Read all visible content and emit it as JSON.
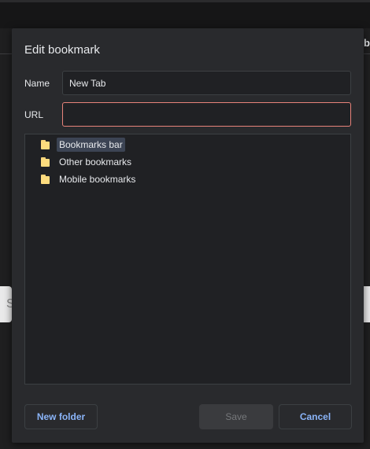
{
  "background": {
    "right_edge_text": "b",
    "left_edge_text": "S"
  },
  "dialog": {
    "title": "Edit bookmark",
    "name_label": "Name",
    "name_value": "New Tab",
    "url_label": "URL",
    "url_value": "",
    "folders": [
      {
        "label": "Bookmarks bar",
        "selected": true
      },
      {
        "label": "Other bookmarks",
        "selected": false
      },
      {
        "label": "Mobile bookmarks",
        "selected": false
      }
    ],
    "buttons": {
      "new_folder": "New folder",
      "save": "Save",
      "cancel": "Cancel"
    }
  },
  "colors": {
    "dialog_bg": "#292a2d",
    "input_bg": "#202124",
    "accent": "#8ab4f8",
    "error_border": "#e8837a",
    "folder": "#fddc7e",
    "selection": "#3c4454"
  }
}
